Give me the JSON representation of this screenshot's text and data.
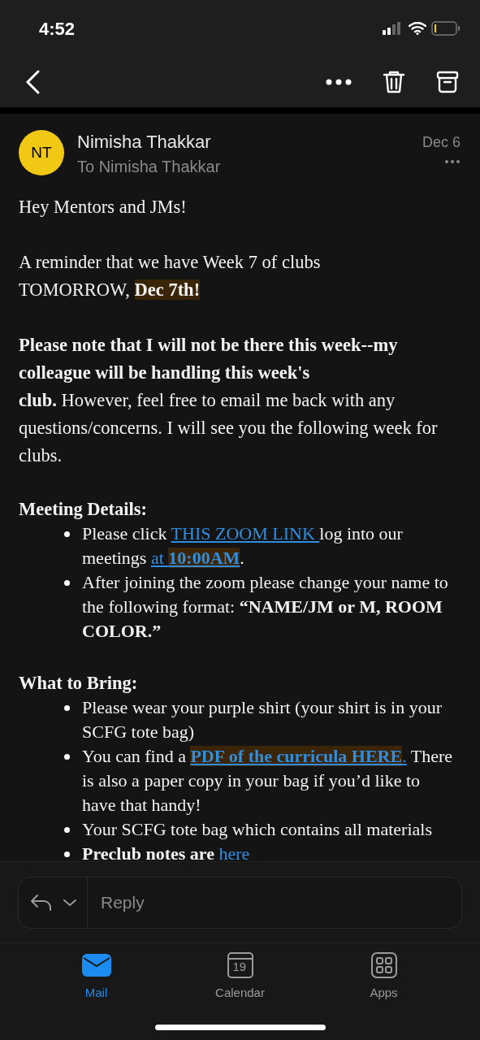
{
  "status_bar": {
    "time": "4:52"
  },
  "sender": {
    "initials": "NT",
    "name": "Nimisha Thakkar",
    "to": "To Nimisha Thakkar",
    "date": "Dec 6"
  },
  "body": [
    {
      "kind": "paragraph",
      "lines": [
        [
          {
            "kind": "text",
            "text": "Hey Mentors and JMs!"
          }
        ]
      ]
    },
    {
      "kind": "paragraph",
      "lines": [
        [
          {
            "kind": "text",
            "text": "A reminder that we have Week 7 of clubs"
          }
        ],
        [
          {
            "kind": "text",
            "text": "TOMORROW, "
          },
          {
            "kind": "highlight_bold",
            "text": "Dec 7th!"
          }
        ]
      ]
    },
    {
      "kind": "paragraph",
      "lines": [
        [
          {
            "kind": "bold",
            "text": "Please note that I will not be there this week--my colleague will be handling this week's"
          }
        ],
        [
          {
            "kind": "bold",
            "text": "club."
          },
          {
            "kind": "text",
            "text": " However, feel free to email me back with any questions/concerns. I will see you the following week for clubs."
          }
        ]
      ]
    },
    {
      "kind": "heading",
      "text": "Meeting Details:"
    },
    {
      "kind": "list",
      "items": [
        [
          {
            "kind": "text",
            "text": "Please click "
          },
          {
            "kind": "link",
            "text": "THIS ZOOM LINK "
          },
          {
            "kind": "text",
            "text": "log into our meetings "
          },
          {
            "kind": "link",
            "text": "at "
          },
          {
            "kind": "highlight_bold_link",
            "text": "10:00AM"
          },
          {
            "kind": "text",
            "text": "."
          }
        ],
        [
          {
            "kind": "text",
            "text": "After joining the zoom please change your name to the following format: "
          },
          {
            "kind": "bold",
            "text": "“NAME/JM or M, ROOM COLOR.”"
          }
        ]
      ]
    },
    {
      "kind": "heading",
      "text": "What to Bring:"
    },
    {
      "kind": "list",
      "items": [
        [
          {
            "kind": "text",
            "text": "Please wear your purple shirt (your shirt is in your SCFG tote bag)"
          }
        ],
        [
          {
            "kind": "text",
            "text": "You can find a "
          },
          {
            "kind": "highlight_bold_link",
            "text": "PDF of the curricula HERE"
          },
          {
            "kind": "link",
            "text": "."
          },
          {
            "kind": "text",
            "text": " There is also a paper copy in your bag if you’d like to have that handy!"
          }
        ],
        [
          {
            "kind": "text",
            "text": "Your SCFG tote bag which contains all materials"
          }
        ],
        [
          {
            "kind": "bold",
            "text": "Preclub notes are "
          },
          {
            "kind": "link",
            "text": "here"
          }
        ]
      ]
    }
  ],
  "reply": {
    "placeholder": "Reply"
  },
  "tabs": [
    {
      "label": "Mail",
      "selected": true
    },
    {
      "label": "Calendar",
      "badge": "19",
      "selected": false
    },
    {
      "label": "Apps",
      "selected": false
    }
  ]
}
